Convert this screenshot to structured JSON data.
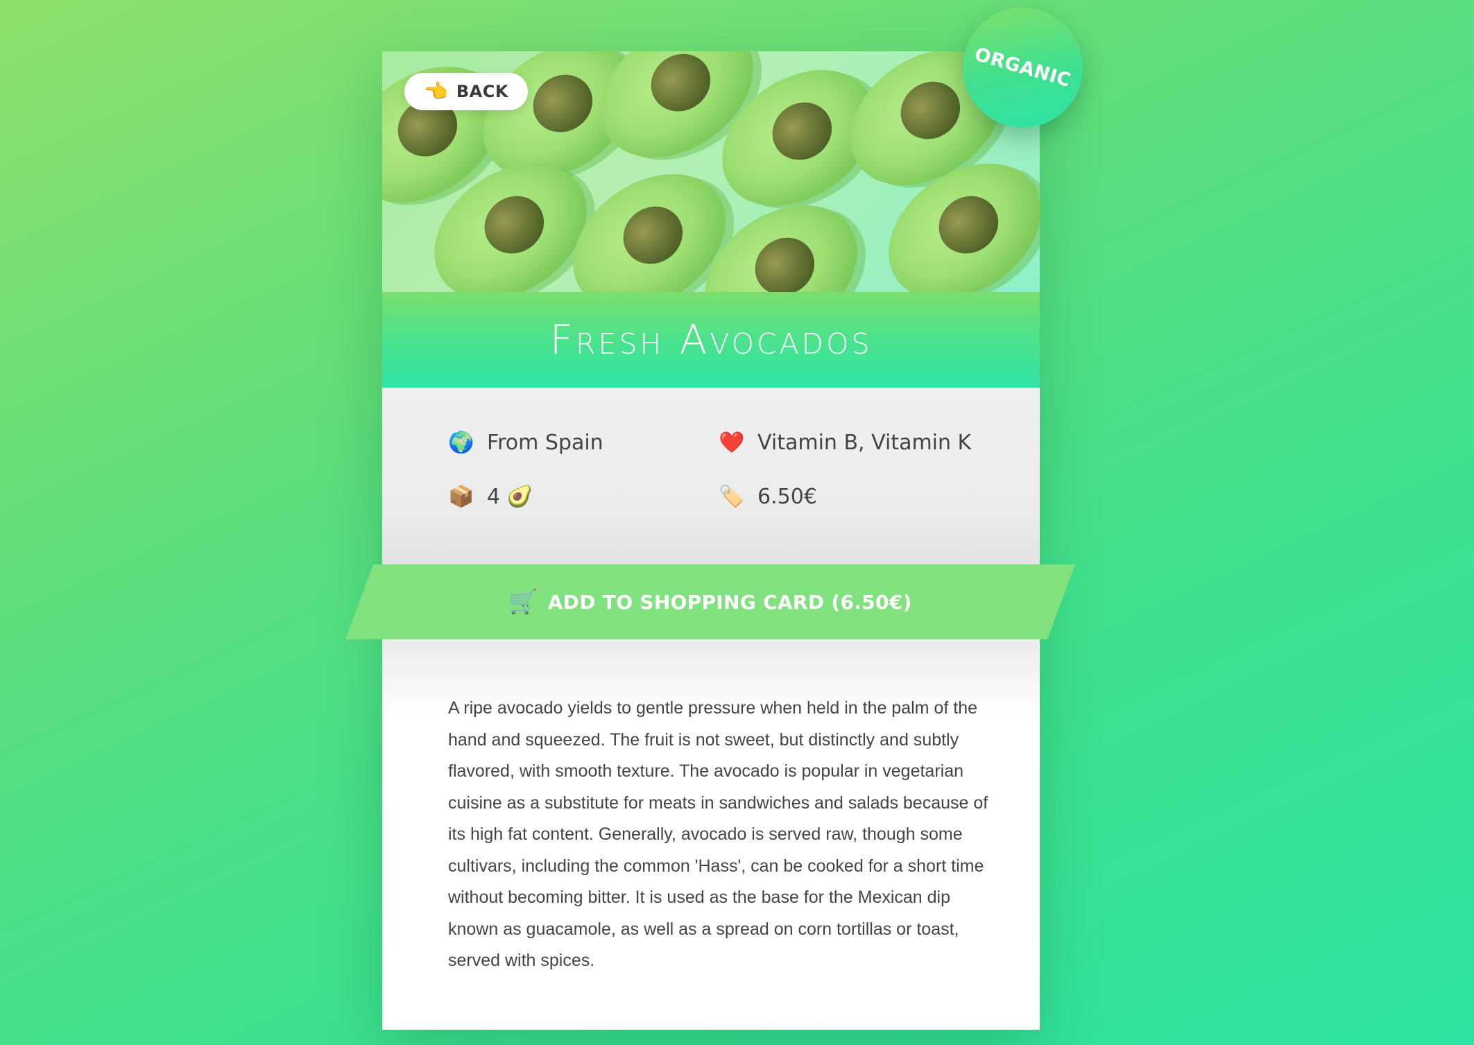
{
  "navigation": {
    "back_icon": "pointing-hand-icon",
    "back_glyph": "👈",
    "back_label": "BACK"
  },
  "badge": {
    "label": "ORGANIC"
  },
  "product": {
    "title": "Fresh Avocados",
    "image_subject": "avocado-halves-pattern"
  },
  "info": {
    "origin": {
      "icon": "globe-icon",
      "glyph": "🌍",
      "text": "From Spain"
    },
    "vitamins": {
      "icon": "heart-icon",
      "glyph": "❤️",
      "text": "Vitamin B, Vitamin K"
    },
    "quantity": {
      "icon": "package-icon",
      "glyph": "📦",
      "text": "4 🥑"
    },
    "price": {
      "icon": "price-tag-icon",
      "glyph": "🏷️",
      "text": "6.50€"
    }
  },
  "cta": {
    "icon": "shopping-cart-icon",
    "glyph": "🛒",
    "label": "ADD TO SHOPPING CARD (6.50€)"
  },
  "description": "A ripe avocado yields to gentle pressure when held in the palm of the hand and squeezed. The fruit is not sweet, but distinctly and subtly flavored, with smooth texture. The avocado is popular in vegetarian cuisine as a substitute for meats in sandwiches and salads because of its high fat content. Generally, avocado is served raw, though some cultivars, including the common 'Hass', can be cooked for a short time without becoming bitter. It is used as the base for the Mexican dip known as guacamole, as well as a spread on corn tortillas or toast, served with spices.",
  "colors": {
    "background_start": "#8ee06a",
    "background_end": "#2ee3a0",
    "accent_green": "#80e27e",
    "title_band_top": "#7ade6e",
    "title_band_bottom": "#2ee3a5",
    "text": "#444444"
  }
}
